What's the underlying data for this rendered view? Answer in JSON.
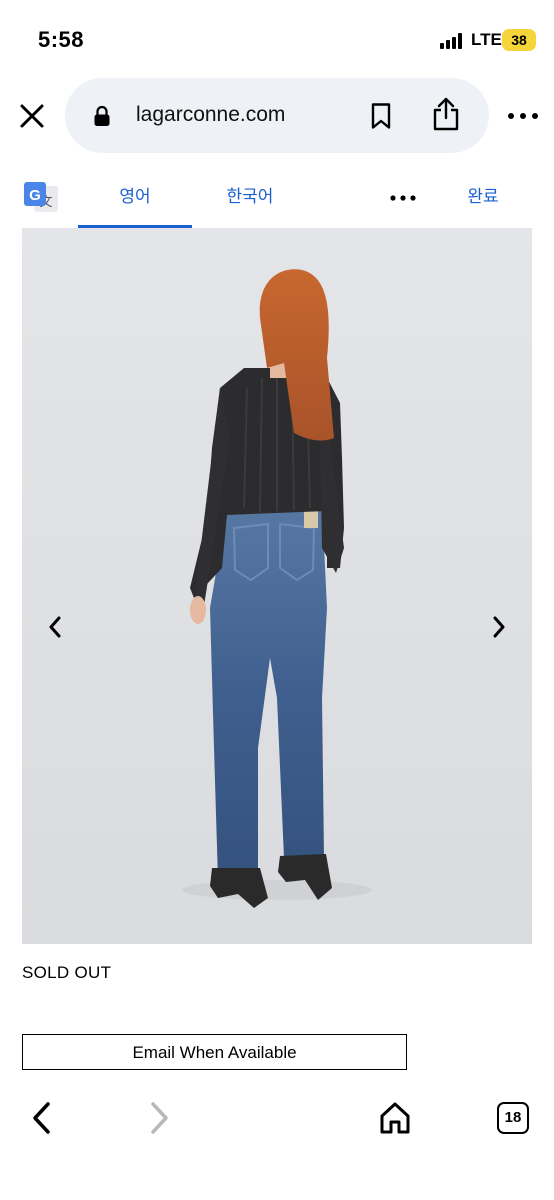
{
  "status_bar": {
    "time": "5:58",
    "network": "LTE",
    "battery": "38",
    "battery_color": "#f5d53a"
  },
  "browser": {
    "url": "lagarconne.com",
    "icons": [
      "close-icon",
      "lock-icon",
      "bookmark-icon",
      "share-icon",
      "more-icon"
    ]
  },
  "translate": {
    "tab_source": "영어",
    "tab_target": "한국어",
    "done_label": "완료",
    "accent_color": "#1a5fd0"
  },
  "product": {
    "availability": "SOLD OUT",
    "email_button": "Email When Available"
  },
  "toolbar": {
    "tab_count": "18",
    "icons": [
      "back-icon",
      "forward-icon",
      "home-icon",
      "tabs-icon"
    ]
  }
}
